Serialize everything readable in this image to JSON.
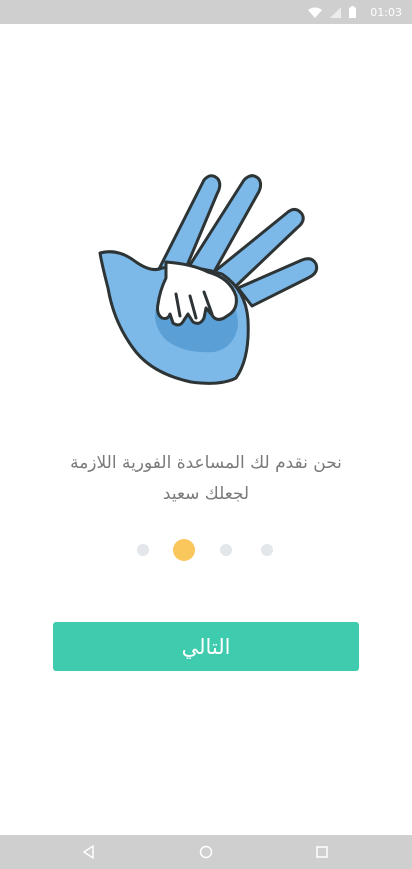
{
  "status_bar": {
    "time": "01:03",
    "icons": [
      "wifi-icon",
      "signal-icon",
      "battery-icon"
    ]
  },
  "onboarding": {
    "illustration": "helping-hands-illustration",
    "description_line1": "نحن نقدم لك المساعدة الفورية اللازمة",
    "description_line2": "لجعلك سعيد",
    "page_indicator": {
      "total": 4,
      "current": 2
    },
    "next_button_label": "التالي"
  },
  "nav_bar": {
    "buttons": [
      "back-icon",
      "home-icon",
      "recents-icon"
    ]
  },
  "colors": {
    "accent": "#3fcbad",
    "dot_active": "#f9c75b",
    "dot_inactive": "#e3e6ea",
    "hand_fill": "#7cb8e8",
    "text": "#7a7a7a"
  }
}
